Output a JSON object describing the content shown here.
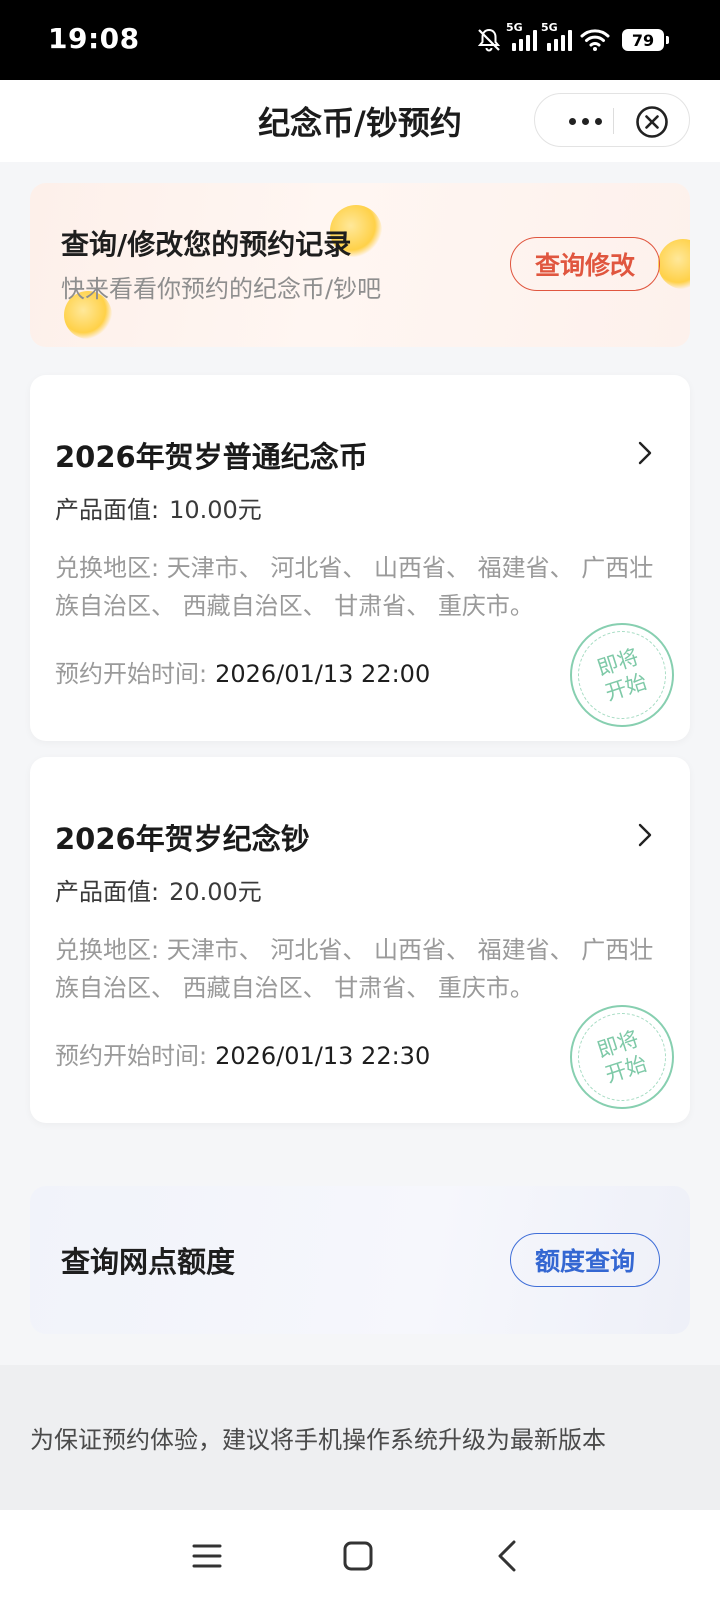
{
  "status_bar": {
    "time": "19:08",
    "network_1": "5G",
    "network_2": "5G",
    "battery": "79",
    "icons": [
      "bell-muted-icon",
      "signal-icon",
      "signal-icon",
      "wifi-icon",
      "battery-icon"
    ]
  },
  "nav": {
    "title": "纪念币/钞预约",
    "more_icon": "more-dots-icon",
    "close_icon": "close-circle-icon"
  },
  "banner": {
    "title": "查询/修改您的预约记录",
    "subtitle": "快来看看你预约的纪念币/钞吧",
    "button": "查询修改"
  },
  "products": [
    {
      "title": "2026年贺岁普通纪念币",
      "face_label": "产品面值:",
      "face_value": "10.00元",
      "region_label": "兑换地区:",
      "regions": "天津市、 河北省、 山西省、 福建省、 广西壮族自治区、 西藏自治区、 甘肃省、 重庆市。",
      "start_label": "预约开始时间:",
      "start_time": "2026/01/13 22:00",
      "stamp_line1": "即将",
      "stamp_line2": "开始"
    },
    {
      "title": "2026年贺岁纪念钞",
      "face_label": "产品面值:",
      "face_value": "20.00元",
      "region_label": "兑换地区:",
      "regions": "天津市、 河北省、 山西省、 福建省、 广西壮族自治区、 西藏自治区、 甘肃省、 重庆市。",
      "start_label": "预约开始时间:",
      "start_time": "2026/01/13 22:30",
      "stamp_line1": "即将",
      "stamp_line2": "开始"
    }
  ],
  "quota": {
    "title": "查询网点额度",
    "button": "额度查询"
  },
  "notice": "为保证预约体验，建议将手机操作系统升级为最新版本",
  "system_nav": {
    "icons": [
      "menu-icon",
      "home-icon",
      "back-icon"
    ]
  },
  "colors": {
    "accent_red": "#e0563f",
    "accent_blue": "#3467d2",
    "stamp_green": "#7ec9a7"
  }
}
